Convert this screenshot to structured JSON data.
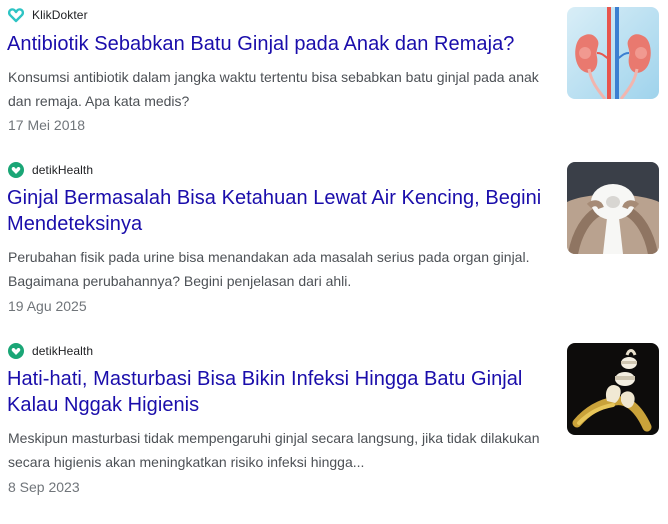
{
  "results": [
    {
      "source": "KlikDokter",
      "favicon": "klikdokter-heart-icon",
      "favicon_color": "#2ec4c4",
      "title": "Antibiotik Sebabkan Batu Ginjal pada Anak dan Remaja?",
      "snippet": "Konsumsi antibiotik dalam jangka waktu tertentu bisa sebabkan batu ginjal pada anak dan remaja. Apa kata medis?",
      "date": "17 Mei 2018",
      "thumbnail": "kidney-illustration-image"
    },
    {
      "source": "detikHealth",
      "favicon": "detikhealth-heart-icon",
      "favicon_color": "#1aa676",
      "title": "Ginjal Bermasalah Bisa Ketahuan Lewat Air Kencing, Begini Mendeteksinya",
      "snippet": "Perubahan fisik pada urine bisa menandakan ada masalah serius pada organ ginjal. Bagaimana perubahannya? Begini penjelasan dari ahli.",
      "date": "19 Agu 2025",
      "thumbnail": "toilet-paper-photo"
    },
    {
      "source": "detikHealth",
      "favicon": "detikhealth-heart-icon",
      "favicon_color": "#1aa676",
      "title": "Hati-hati, Masturbasi Bisa Bikin Infeksi Hingga Batu Ginjal Kalau Nggak Higienis",
      "snippet": "Meskipun masturbasi tidak mempengaruhi ginjal secara langsung, jika tidak dilakukan secara higienis akan meningkatkan risiko infeksi hingga...",
      "date": "8 Sep 2023",
      "thumbnail": "peeled-banana-photo"
    }
  ],
  "colors": {
    "title_link": "#1a0dab",
    "snippet_text": "#4d5156",
    "date_text": "#70757a"
  }
}
